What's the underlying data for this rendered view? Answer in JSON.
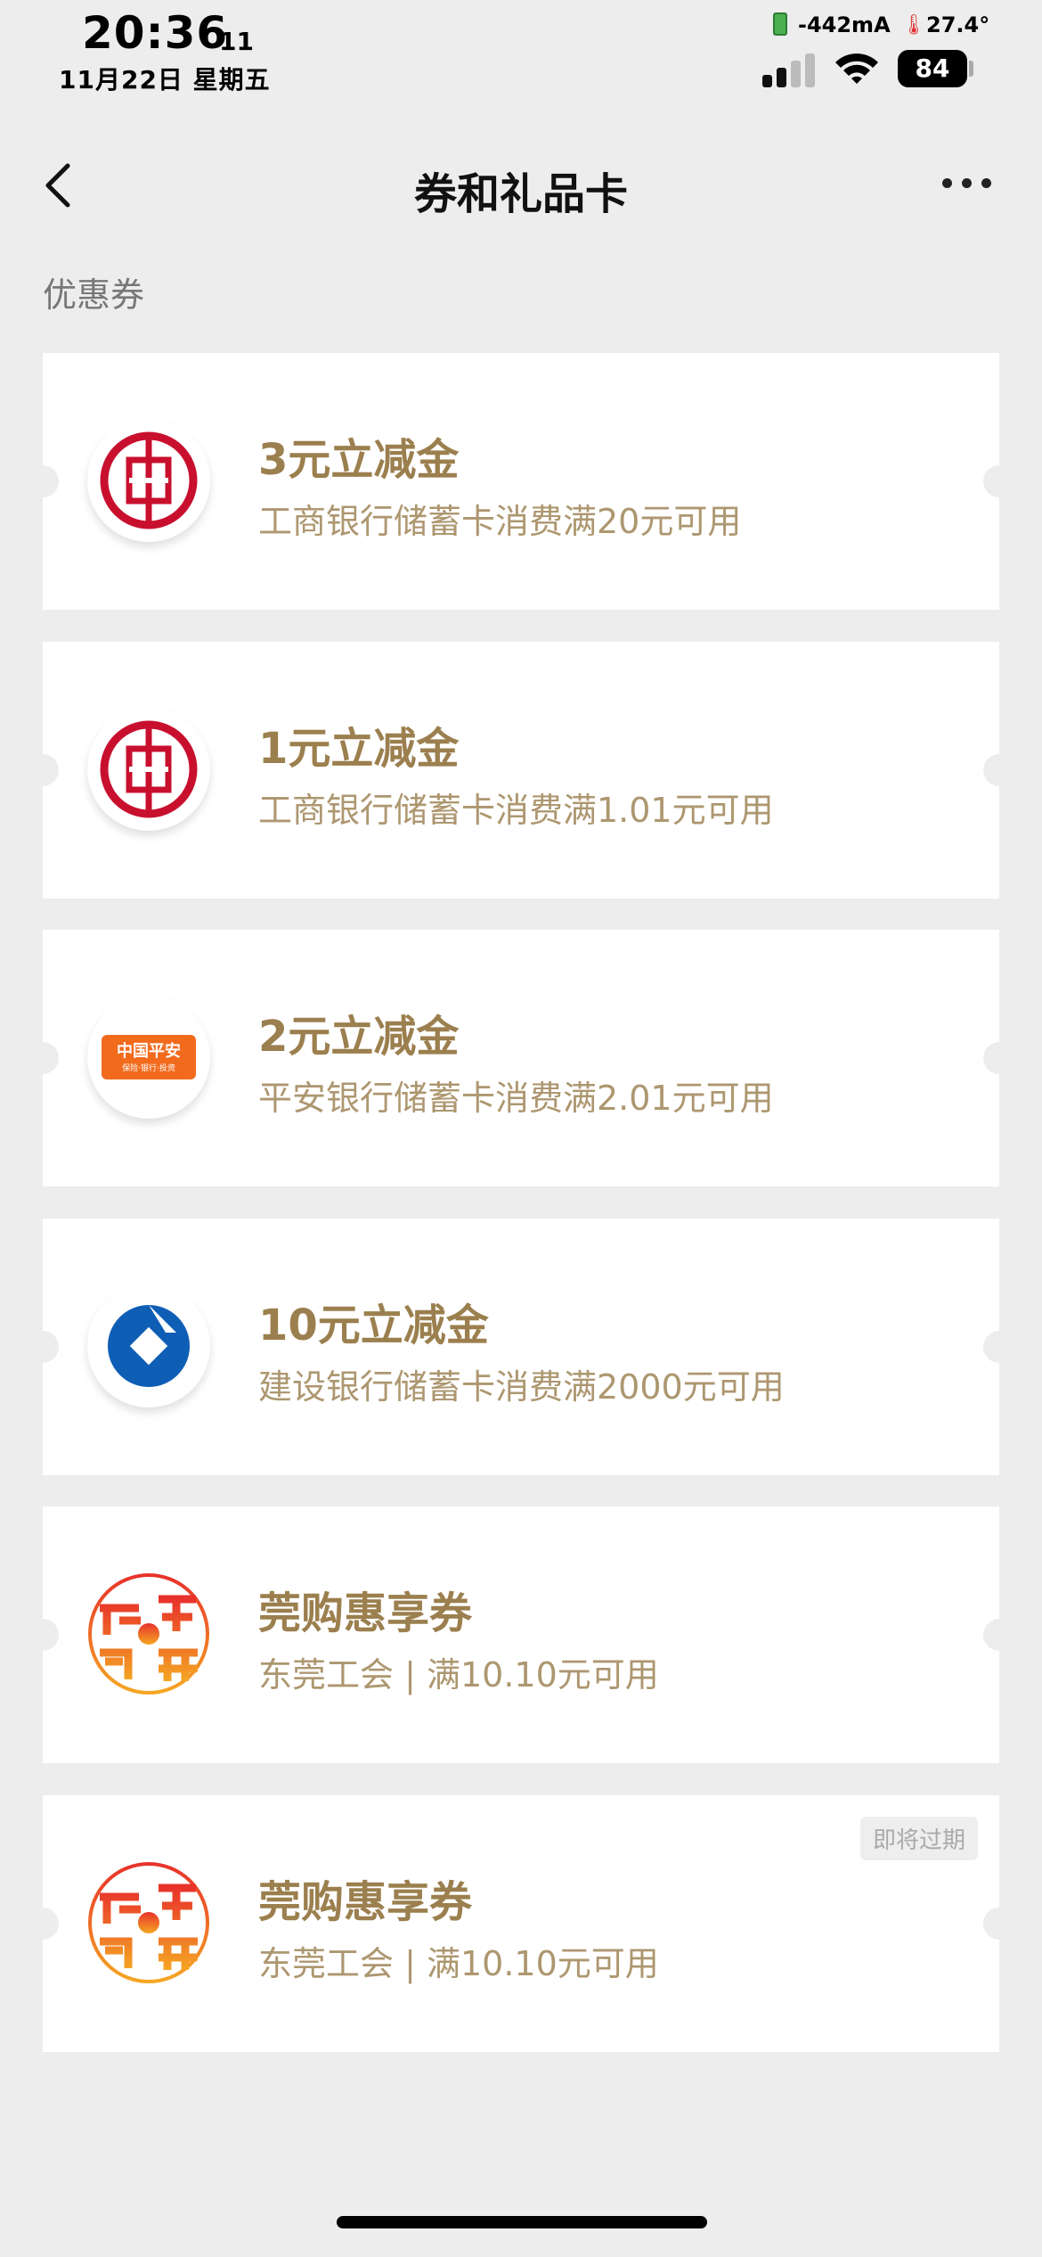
{
  "status": {
    "time": "20:36",
    "time_seconds": "11",
    "date": "11月22日 星期五",
    "current": "-442mA",
    "temperature": "27.4°",
    "battery": "84"
  },
  "nav": {
    "title": "券和礼品卡"
  },
  "section": {
    "title": "优惠券"
  },
  "coupons": [
    {
      "title": "3元立减金",
      "desc": "工商银行储蓄卡消费满20元可用",
      "logo": "icbc-logo-icon"
    },
    {
      "title": "1元立减金",
      "desc": "工商银行储蓄卡消费满1.01元可用",
      "logo": "icbc-logo-icon"
    },
    {
      "title": "2元立减金",
      "desc": "平安银行储蓄卡消费满2.01元可用",
      "logo": "pingan-logo-icon",
      "logo_text": "中国平安",
      "logo_subtext": "保险·银行·投资"
    },
    {
      "title": "10元立减金",
      "desc": "建设银行储蓄卡消费满2000元可用",
      "logo": "ccb-logo-icon"
    },
    {
      "title": "莞购惠享券",
      "desc": "东莞工会 | 满10.10元可用",
      "logo": "dongguan-union-logo-icon"
    },
    {
      "title": "莞购惠享券",
      "desc": "东莞工会 | 满10.10元可用",
      "logo": "dongguan-union-logo-icon",
      "badge": "即将过期"
    }
  ],
  "colors": {
    "coupon_title": "#9b7f4e",
    "coupon_desc": "#ad9770",
    "icbc_red": "#c8102e",
    "pingan_orange": "#f26b1d",
    "ccb_blue": "#0f5eb5"
  }
}
